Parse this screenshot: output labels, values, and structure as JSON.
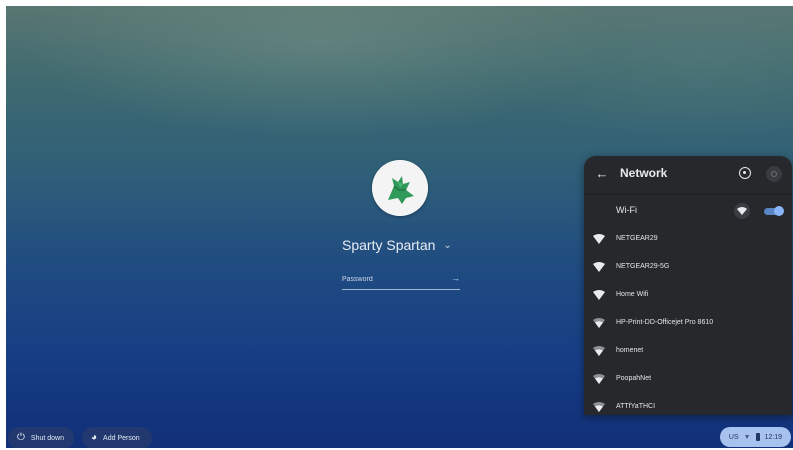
{
  "login": {
    "user_name": "Sparty Spartan",
    "password_placeholder": "Password"
  },
  "network_panel": {
    "title": "Network",
    "wifi_label": "Wi-Fi",
    "wifi_enabled": true,
    "networks": [
      {
        "name": "NETGEAR29",
        "icon": "wifi-full-icon"
      },
      {
        "name": "NETGEAR29-5G",
        "icon": "wifi-full-icon"
      },
      {
        "name": "Home Wifi",
        "icon": "wifi-full-icon"
      },
      {
        "name": "HP-Print-DD-Officejet Pro 8610",
        "icon": "wifi-medium-icon"
      },
      {
        "name": "homenet",
        "icon": "wifi-medium-icon"
      },
      {
        "name": "PoopahNet",
        "icon": "wifi-medium-icon"
      },
      {
        "name": "ATTfYaTHCI",
        "icon": "wifi-medium-icon"
      }
    ]
  },
  "shelf": {
    "shutdown_label": "Shut down",
    "add_person_label": "Add Person",
    "tray": {
      "keyboard_layout": "US",
      "time": "12:19"
    }
  },
  "colors": {
    "panel_bg": "#27282c",
    "accent": "#8ab4f8",
    "tray_bg": "#a7c2ee"
  }
}
